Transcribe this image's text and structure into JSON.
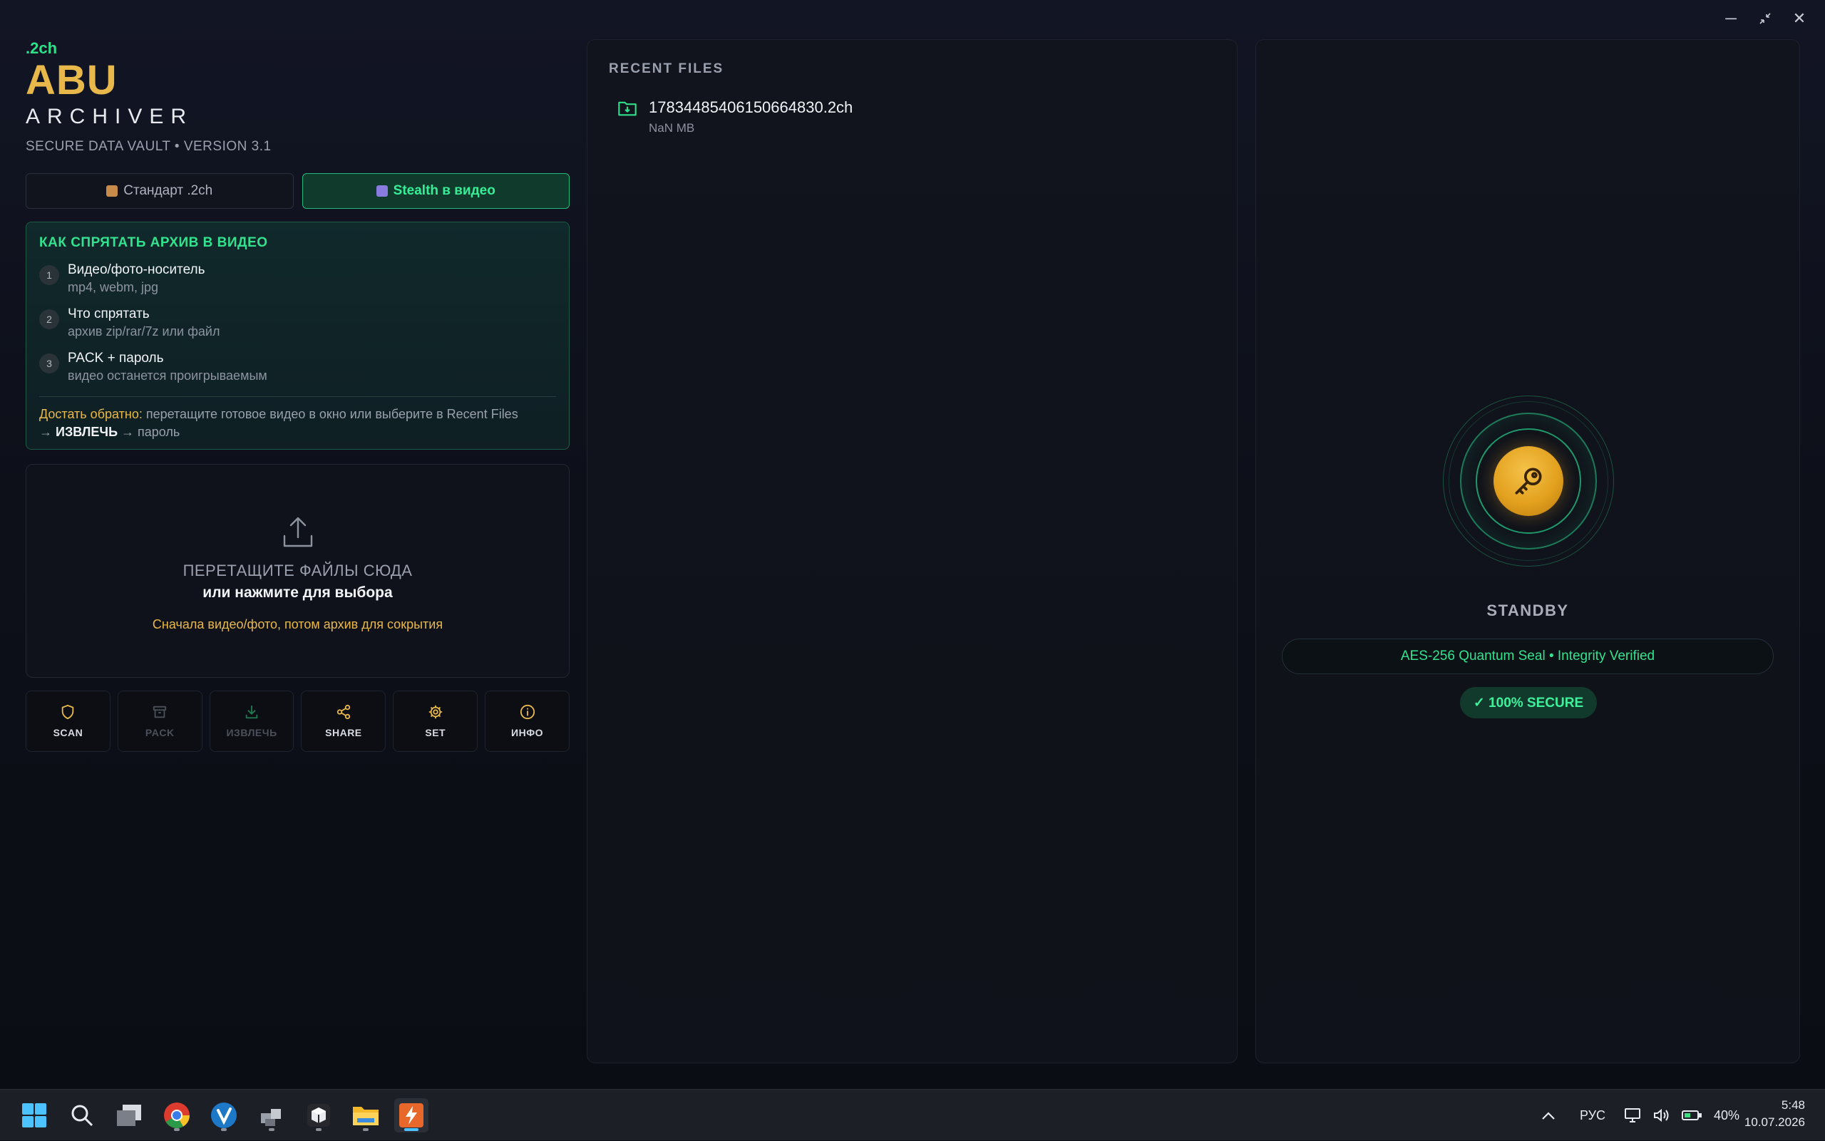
{
  "window": {
    "minimize": "─",
    "restore": "⤡",
    "close": "✕"
  },
  "brand": {
    "tag": ".2ch",
    "name": "ABU",
    "subtitle": "ARCHIVER",
    "version_line": "SECURE DATA VAULT • VERSION 3.1"
  },
  "modes": [
    {
      "label": "Стандарт .2ch",
      "icon": "package-icon",
      "active": false
    },
    {
      "label": "Stealth в видео",
      "icon": "clapperboard-icon",
      "active": true
    }
  ],
  "howto": {
    "title": "КАК СПРЯТАТЬ АРХИВ В ВИДЕО",
    "steps": [
      {
        "num": "1",
        "title": "Видео/фото-носитель",
        "desc": "mp4, webm, jpg"
      },
      {
        "num": "2",
        "title": "Что спрятать",
        "desc": "архив zip/rar/7z или файл"
      },
      {
        "num": "3",
        "title": "PACK + пароль",
        "desc": "видео останется проигрываемым"
      }
    ],
    "note_highlight": "Достать обратно:",
    "note_text": " перетащите готовое видео в окно или выберите в Recent Files",
    "note_arrow1": "→ ",
    "note_bold": "ИЗВЛЕЧЬ",
    "note_tail": " → пароль"
  },
  "dropzone": {
    "icon": "upload-icon",
    "title": "ПЕРЕТАЩИТЕ ФАЙЛЫ СЮДА",
    "subtitle": "или нажмите для выбора",
    "hint": "Сначала видео/фото, потом архив для сокрытия"
  },
  "actions": [
    {
      "label": "SCAN",
      "icon": "shield-icon",
      "enabled": true
    },
    {
      "label": "PACK",
      "icon": "archive-box-icon",
      "enabled": false
    },
    {
      "label": "ИЗВЛЕЧЬ",
      "icon": "download-icon",
      "enabled": false
    },
    {
      "label": "SHARE",
      "icon": "share-icon",
      "enabled": true
    },
    {
      "label": "SET",
      "icon": "gear-icon",
      "enabled": true
    },
    {
      "label": "ИНФО",
      "icon": "info-icon",
      "enabled": true
    }
  ],
  "recent": {
    "label": "RECENT FILES",
    "files": [
      {
        "name": "17834485406150664830.2ch",
        "size": "NaN MB",
        "icon": "folder-download-icon"
      }
    ]
  },
  "status_panel": {
    "icon": "key-icon",
    "status": "STANDBY",
    "seal": "AES-256 Quantum Seal • Integrity Verified",
    "secure_badge": "✓ 100% SECURE"
  },
  "colors": {
    "accent_green": "#33e28f",
    "accent_gold": "#e9b84a",
    "background": "#0d1019"
  },
  "taskbar": {
    "apps": [
      "windows-start-icon",
      "search-icon",
      "task-view-icon",
      "chrome-icon",
      "app-v-icon",
      "package-manager-icon",
      "cube-app-icon",
      "file-explorer-icon",
      "abu-archiver-icon"
    ],
    "tray": {
      "language": "РУС",
      "battery": "40%"
    },
    "clock": {
      "time": "5:48",
      "date": "10.07.2026"
    }
  }
}
